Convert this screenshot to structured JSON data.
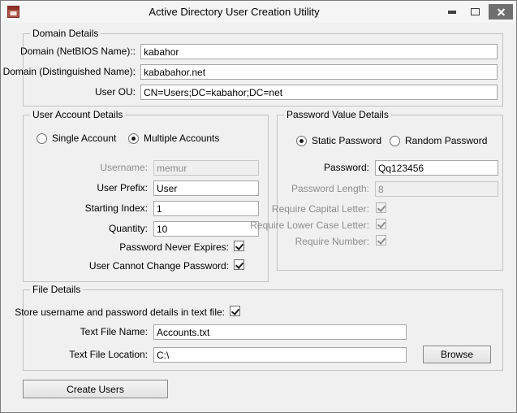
{
  "window": {
    "title": "Active Directory User Creation Utility"
  },
  "colors": {
    "form_background": "#f0f0f0",
    "close_button_background": "#6f6f6f",
    "app_icon_red": "#8c2f26"
  },
  "domain_details": {
    "title": "Domain Details",
    "netbios": {
      "label": "Domain (NetBIOS Name)::",
      "value": "kabahor"
    },
    "distinguished": {
      "label": "Domain (Distinguished Name):",
      "value": "kababahor.net"
    },
    "user_ou": {
      "label": "User OU:",
      "value": "CN=Users;DC=kabahor;DC=net"
    }
  },
  "user_account": {
    "title": "User Account Details",
    "single_account": {
      "label": "Single Account",
      "selected": false
    },
    "multiple_accounts": {
      "label": "Multiple Accounts",
      "selected": true
    },
    "username": {
      "label": "Username:",
      "value": "memur",
      "enabled": false
    },
    "user_prefix": {
      "label": "User Prefix:",
      "value": "User"
    },
    "starting_index": {
      "label": "Starting Index:",
      "value": "1"
    },
    "quantity": {
      "label": "Quantity:",
      "value": "10"
    },
    "password_never_expires": {
      "label": "Password Never Expires:",
      "checked": true
    },
    "user_cannot_change_password": {
      "label": "User Cannot Change Password:",
      "checked": true
    }
  },
  "password_details": {
    "title": "Password Value Details",
    "static_password": {
      "label": "Static Password",
      "selected": true
    },
    "random_password": {
      "label": "Random Password",
      "selected": false
    },
    "password": {
      "label": "Password:",
      "value": "Qq123456"
    },
    "password_length": {
      "label": "Password Length:",
      "value": "8",
      "enabled": false
    },
    "require_capital": {
      "label": "Require Capital Letter:",
      "checked": true,
      "enabled": false
    },
    "require_lower": {
      "label": "Require Lower Case Letter:",
      "checked": true,
      "enabled": false
    },
    "require_number": {
      "label": "Require Number:",
      "checked": true,
      "enabled": false
    }
  },
  "file_details": {
    "title": "File Details",
    "store_in_text_file": {
      "label": "Store username and password details in text file:",
      "checked": true
    },
    "text_file_name": {
      "label": "Text File Name:",
      "value": "Accounts.txt"
    },
    "text_file_location": {
      "label": "Text File Location:",
      "value": "C:\\"
    },
    "browse_button": "Browse"
  },
  "actions": {
    "create_users": "Create Users"
  }
}
